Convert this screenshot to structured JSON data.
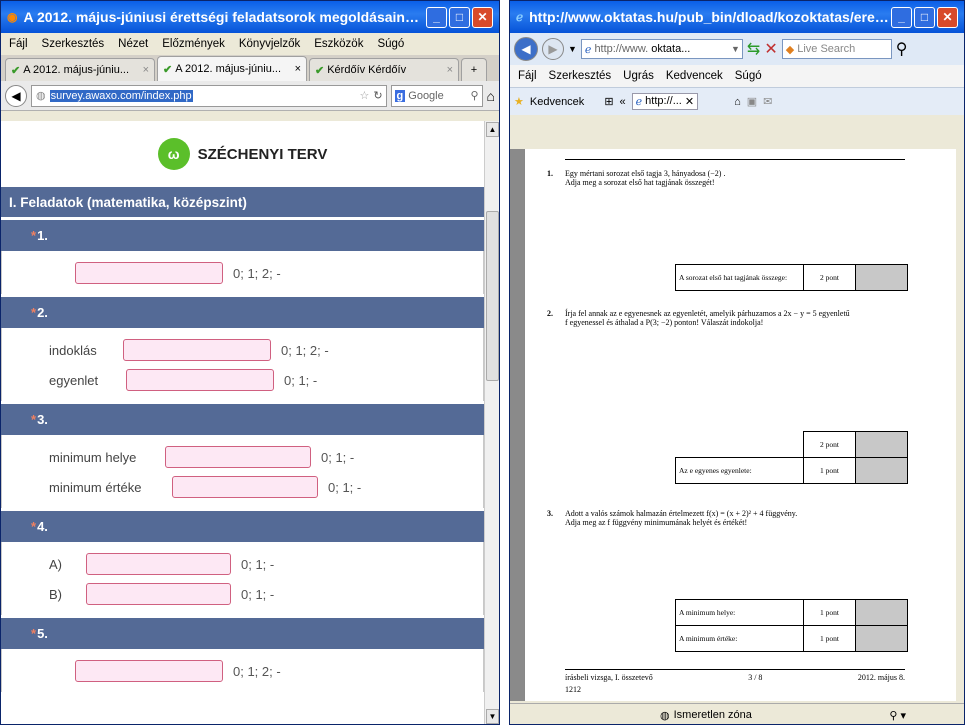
{
  "firefox": {
    "title": "A 2012. május-júniusi érettségi feladatsorok megoldásainak ...",
    "menu": [
      "Fájl",
      "Szerkesztés",
      "Nézet",
      "Előzmények",
      "Könyvjelzők",
      "Eszközök",
      "Súgó"
    ],
    "tabs": [
      {
        "label": "A 2012. május-júniu..."
      },
      {
        "label": "A 2012. május-júniu..."
      },
      {
        "label": "Kérdőív Kérdőív"
      }
    ],
    "url": "survey.awaxo.com/index.php",
    "search_placeholder": "Google",
    "logo_text": "SZÉCHENYI TERV",
    "logo_mark": "ω",
    "section_title": "I. Feladatok (matematika, középszint)",
    "questions": [
      {
        "num": "1.",
        "rows": [
          {
            "label": "",
            "options": "0; 1; 2; -"
          }
        ]
      },
      {
        "num": "2.",
        "rows": [
          {
            "label": "indoklás",
            "options": "0; 1; 2; -"
          },
          {
            "label": "egyenlet",
            "options": "0; 1; -"
          }
        ]
      },
      {
        "num": "3.",
        "rows": [
          {
            "label": "minimum helye",
            "options": "0; 1; -"
          },
          {
            "label": "minimum értéke",
            "options": "0; 1; -"
          }
        ]
      },
      {
        "num": "4.",
        "rows": [
          {
            "label": "A)",
            "options": "0; 1; -"
          },
          {
            "label": "B)",
            "options": "0; 1; -"
          }
        ]
      },
      {
        "num": "5.",
        "rows": [
          {
            "label": "",
            "options": "0; 1; 2; -"
          }
        ]
      }
    ]
  },
  "ie": {
    "title": "http://www.oktatas.hu/pub_bin/dload/kozoktatas/eretts...",
    "url_prefix": "http://www.",
    "url_bold": "oktata...",
    "live_search": "Live Search",
    "menu": [
      "Fájl",
      "Szerkesztés",
      "Ugrás",
      "Kedvencek",
      "Súgó"
    ],
    "favorites": "Kedvencek",
    "tab_label": "http://...",
    "doc": {
      "t1": {
        "num": "1.",
        "line1": "Egy mértani sorozat első tagja 3, hányadosa (−2) .",
        "line2": "Adja meg a sorozat első hat tagjának összegét!"
      },
      "table1": {
        "label": "A sorozat első hat tagjának összege:",
        "points": "2 pont"
      },
      "t2": {
        "num": "2.",
        "line1": "Írja fel annak az e egyenesnek az egyenletét, amelyik párhuzamos a  2x − y = 5  egyenletű",
        "line2": "f egyenessel és áthalad a P(3; −2) ponton! Válaszát indokolja!"
      },
      "table2": {
        "points1": "2 pont",
        "label": "Az e egyenes egyenlete:",
        "points2": "1 pont"
      },
      "t3": {
        "num": "3.",
        "line1": "Adott a valós számok halmazán értelmezett  f(x) = (x + 2)² + 4  függvény.",
        "line2": "Adja meg az f függvény minimumának helyét és értékét!"
      },
      "table3": {
        "label1": "A minimum helye:",
        "points1": "1 pont",
        "label2": "A minimum értéke:",
        "points2": "1 pont"
      },
      "footer_left": "írásbeli vizsga, I. összetevő",
      "footer_code": "1212",
      "footer_page": "3 / 8",
      "footer_right": "2012. május 8."
    },
    "status_zone": "Ismeretlen zóna"
  }
}
